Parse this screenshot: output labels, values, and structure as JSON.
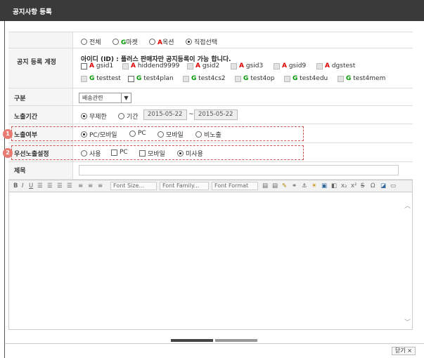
{
  "window": {
    "title": "공지사항 등록",
    "close_label": "닫기 ×"
  },
  "form": {
    "target": {
      "label": "",
      "options": [
        {
          "label": "전체",
          "on": false
        },
        {
          "prefix": "G",
          "label": "마켓",
          "on": false
        },
        {
          "prefix": "A",
          "label": "옥션",
          "on": false
        },
        {
          "label": "직접선택",
          "on": true
        }
      ]
    },
    "account": {
      "label": "공지 등록 계정",
      "note": "아이디 (ID) : 플러스 판매자만 공지등록이 가능 합니다.",
      "row1": [
        {
          "prefix": "A",
          "id": "gsid1"
        },
        {
          "prefix": "A",
          "id": "hiddend9999"
        },
        {
          "prefix": "A",
          "id": "gsid2"
        },
        {
          "prefix": "A",
          "id": "gsid3"
        },
        {
          "prefix": "A",
          "id": "gsid9"
        },
        {
          "prefix": "A",
          "id": "dgstest"
        }
      ],
      "row2": [
        {
          "prefix": "G",
          "id": "testtest"
        },
        {
          "prefix": "G",
          "id": "test4plan"
        },
        {
          "prefix": "G",
          "id": "test4cs2"
        },
        {
          "prefix": "G",
          "id": "test4op"
        },
        {
          "prefix": "G",
          "id": "test4edu"
        },
        {
          "prefix": "G",
          "id": "test4mem"
        }
      ]
    },
    "category": {
      "label": "구분",
      "value": "배송관련"
    },
    "period": {
      "label": "노출기간",
      "unlimited": "무제한",
      "range": "기간",
      "start": "2015-05-22",
      "sep": "~",
      "end": "2015-05-22"
    },
    "exposure": {
      "label": "노출여부",
      "badge": "1",
      "options": [
        "PC/모바일",
        "PC",
        "모바일",
        "비노출"
      ]
    },
    "priority": {
      "label": "우선노출설정",
      "badge": "2",
      "use": "사용",
      "pc": "PC",
      "mobile": "모바일",
      "unused": "미사용"
    },
    "subject": {
      "label": "제목",
      "value": ""
    }
  },
  "editor": {
    "font_size": "Font Size...",
    "font_family": "Font Family...",
    "font_format": "Font Format"
  }
}
